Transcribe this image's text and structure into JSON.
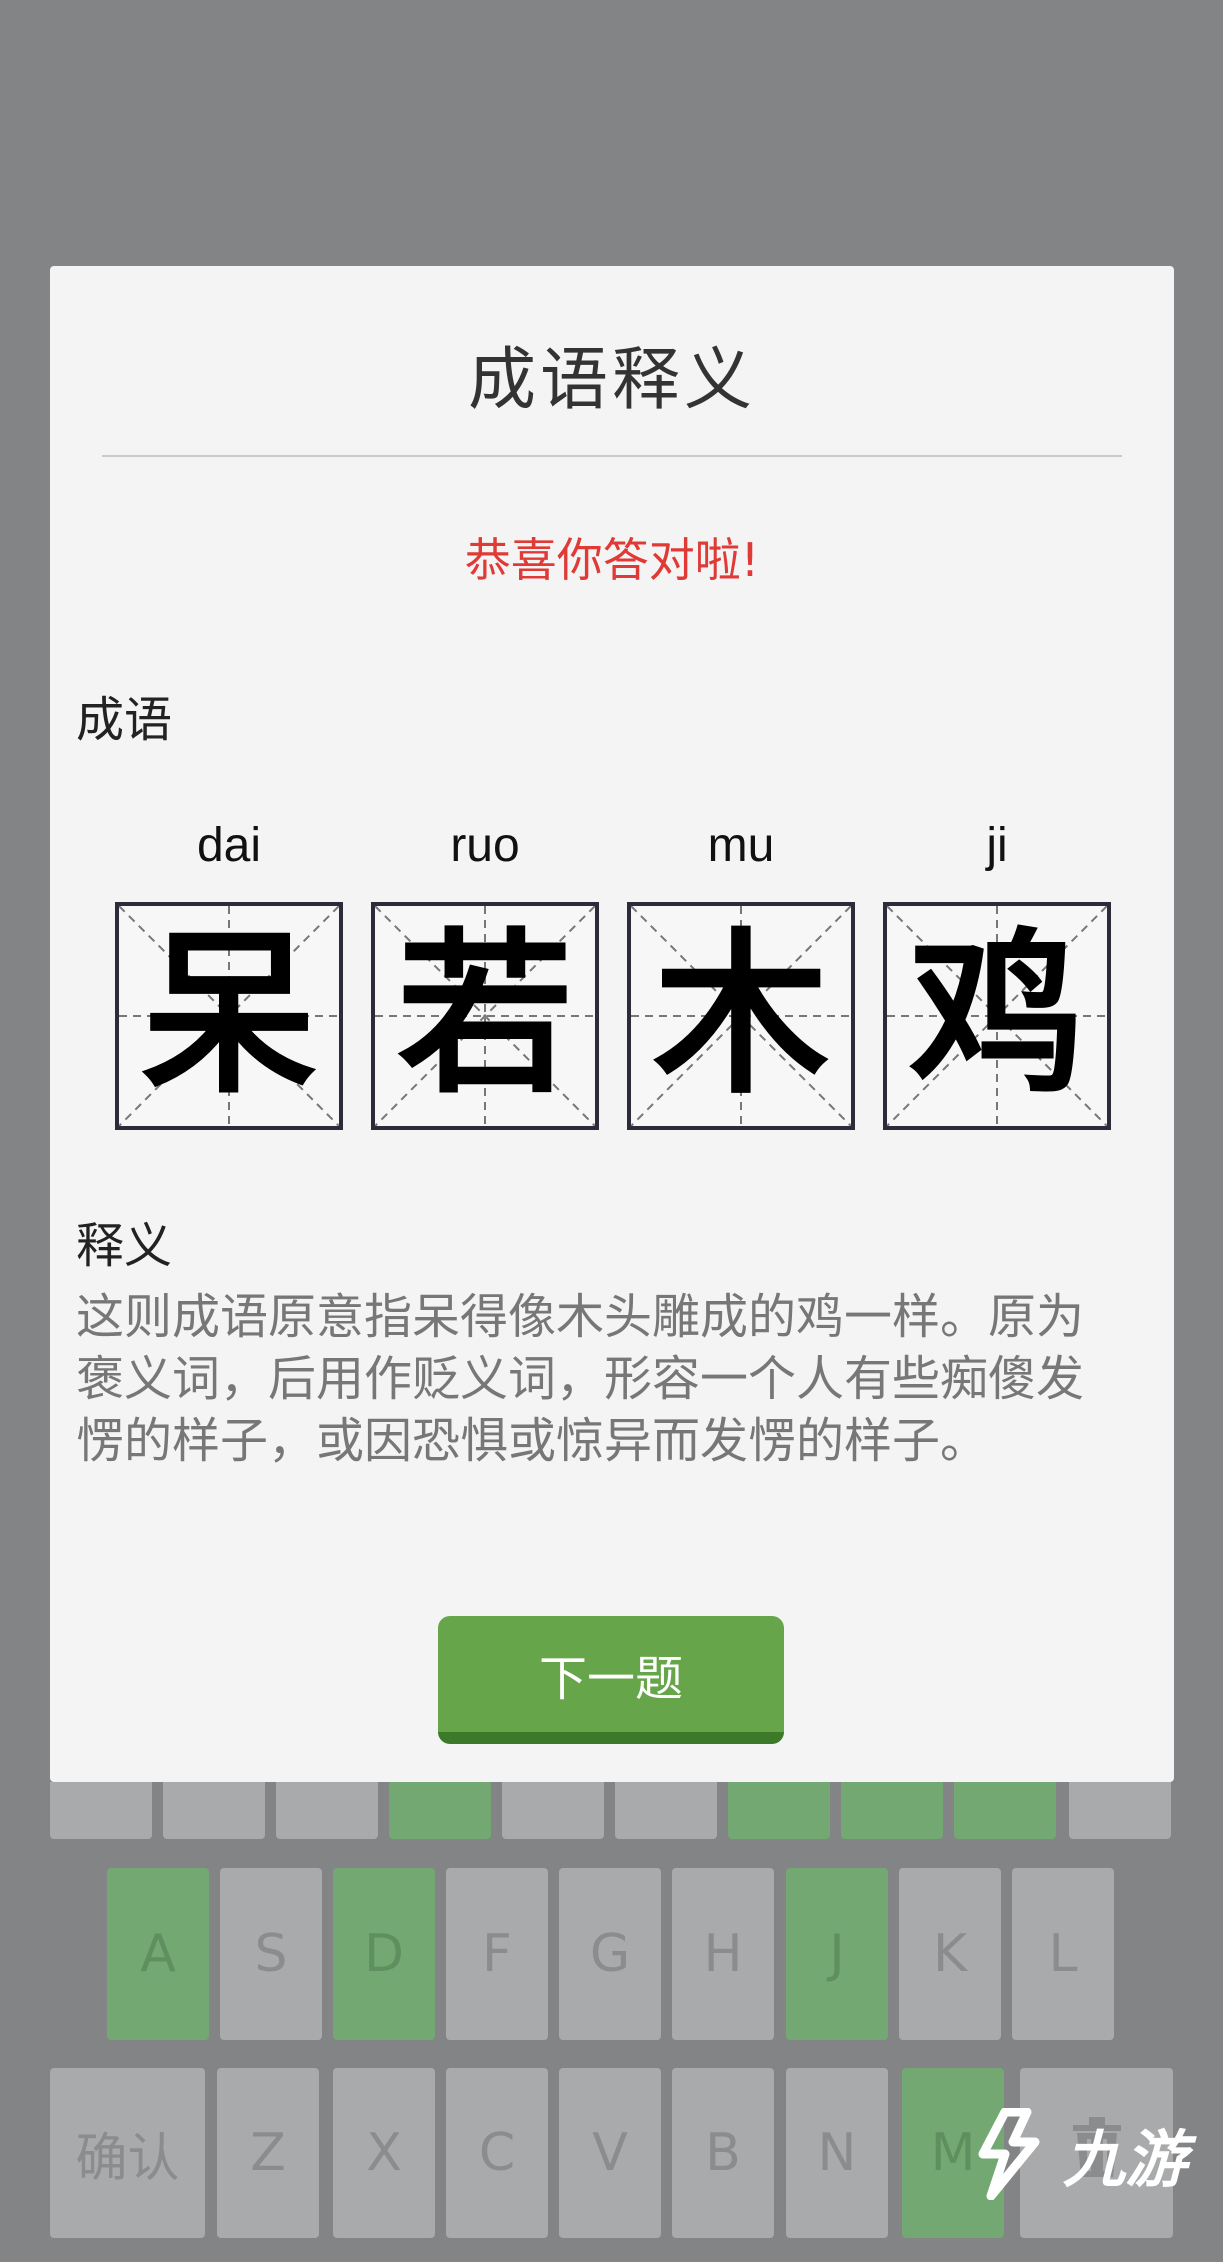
{
  "modal": {
    "title": "成语释义",
    "congrats": "恭喜你答对啦!",
    "idiom_label": "成语",
    "meaning_label": "释义",
    "meaning_text": "这则成语原意指呆得像木头雕成的鸡一样。原为褒义词，后用作贬义词，形容一个人有些痴傻发愣的样子，或因恐惧或惊异而发愣的样子。",
    "next_button": "下一题",
    "characters": [
      {
        "pinyin": "dai",
        "char": "呆"
      },
      {
        "pinyin": "ruo",
        "char": "若"
      },
      {
        "pinyin": "mu",
        "char": "木"
      },
      {
        "pinyin": "ji",
        "char": "鸡"
      }
    ]
  },
  "keyboard": {
    "row2": [
      {
        "label": "A",
        "state": "green"
      },
      {
        "label": "S",
        "state": "gray"
      },
      {
        "label": "D",
        "state": "green"
      },
      {
        "label": "F",
        "state": "gray"
      },
      {
        "label": "G",
        "state": "gray"
      },
      {
        "label": "H",
        "state": "gray"
      },
      {
        "label": "J",
        "state": "green"
      },
      {
        "label": "K",
        "state": "gray"
      },
      {
        "label": "L",
        "state": "gray"
      }
    ],
    "row3": [
      {
        "label": "确认",
        "state": "gray"
      },
      {
        "label": "Z",
        "state": "gray"
      },
      {
        "label": "X",
        "state": "gray"
      },
      {
        "label": "C",
        "state": "gray"
      },
      {
        "label": "V",
        "state": "gray"
      },
      {
        "label": "B",
        "state": "gray"
      },
      {
        "label": "N",
        "state": "gray"
      },
      {
        "label": "M",
        "state": "green"
      },
      {
        "label": "",
        "icon": "trash-icon",
        "state": "gray"
      }
    ],
    "top_strip_states": [
      "gray",
      "gray",
      "gray",
      "green",
      "gray",
      "gray",
      "green",
      "green",
      "green",
      "gray"
    ]
  },
  "watermark": {
    "text": "九游"
  },
  "colors": {
    "accent_green": "#67a54b",
    "congrats_red": "#e03a36",
    "key_green": "#73a872"
  }
}
